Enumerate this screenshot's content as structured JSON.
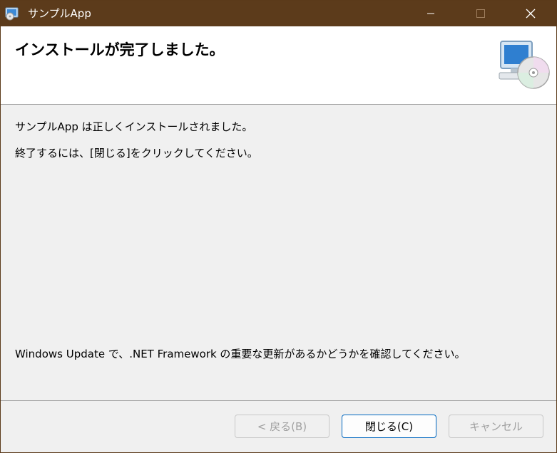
{
  "window": {
    "title": "サンプルApp",
    "titlebar_color": "#5c3b1b",
    "icon": "installer-cd-icon"
  },
  "header": {
    "title": "インストールが完了しました。",
    "icon": "computer-cd-icon"
  },
  "body": {
    "line1": "サンプルApp は正しくインストールされました。",
    "line2": "終了するには、[閉じる]をクリックしてください。",
    "windows_update_note": "Windows Update で、.NET Framework の重要な更新があるかどうかを確認してください。"
  },
  "buttons": {
    "back": "< 戻る(B)",
    "close": "閉じる(C)",
    "cancel": "キャンセル"
  }
}
